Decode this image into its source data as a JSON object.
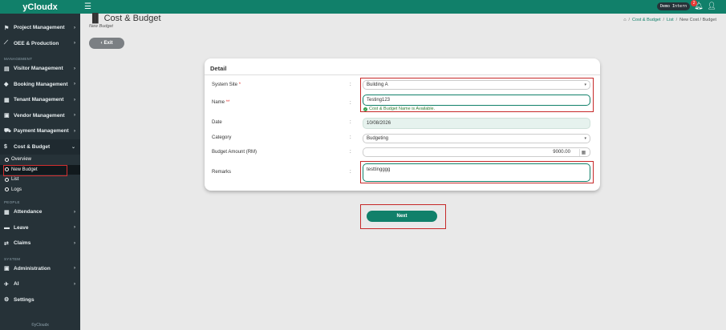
{
  "app": {
    "brand": "yCloudx",
    "footer": "©yCloudx"
  },
  "topbar": {
    "demo_badge": "Demo Intern",
    "notification_count": "2"
  },
  "sidebar": {
    "items_top": [
      {
        "label": "Project Management",
        "icon": "flag-icon"
      },
      {
        "label": "OEE & Production",
        "icon": "chart-line-icon"
      }
    ],
    "section_management": "MANAGEMENT",
    "items_management": [
      {
        "label": "Visitor Management",
        "icon": "id-card-icon"
      },
      {
        "label": "Booking Management",
        "icon": "tag-icon"
      },
      {
        "label": "Tenant Management",
        "icon": "building-icon"
      },
      {
        "label": "Vendor Management",
        "icon": "vendor-card-icon"
      },
      {
        "label": "Payment Management",
        "icon": "cart-icon"
      },
      {
        "label": "Cost & Budget",
        "icon": "dollar-icon"
      }
    ],
    "cost_budget_sub": [
      {
        "label": "Overview"
      },
      {
        "label": "New Budget"
      },
      {
        "label": "List"
      },
      {
        "label": "Logs"
      }
    ],
    "section_people": "PEOPLE",
    "items_people": [
      {
        "label": "Attendance",
        "icon": "calendar-icon"
      },
      {
        "label": "Leave",
        "icon": "briefcase-icon"
      },
      {
        "label": "Claims",
        "icon": "exchange-icon"
      }
    ],
    "section_system": "SYSTEM",
    "items_system": [
      {
        "label": "Administration",
        "icon": "admin-icon"
      },
      {
        "label": "AI",
        "icon": "plane-icon"
      },
      {
        "label": "Settings",
        "icon": "gear-icon"
      }
    ]
  },
  "header": {
    "title": "Cost & Budget",
    "subtitle": "New Budget",
    "breadcrumb": [
      "Cost & Budget",
      "List",
      "New Cost / Budget"
    ]
  },
  "exit_label": "Exit",
  "form": {
    "card_title": "Detail",
    "system_site_label": "System Site",
    "system_site_required": "*",
    "system_site_value": "Building A",
    "name_label": "Name",
    "name_required": "**",
    "name_value": "Testing123",
    "name_available": "Cost & Budget Name is Available.",
    "date_label": "Date",
    "date_value": "10/08/2026",
    "category_label": "Category",
    "category_value": "Budgeting",
    "amount_label": "Budget Amount (RM)",
    "amount_value": "9000.00",
    "remarks_label": "Remarks",
    "remarks_value": "testtingggg",
    "colon": ":"
  },
  "next_label": "Next"
}
